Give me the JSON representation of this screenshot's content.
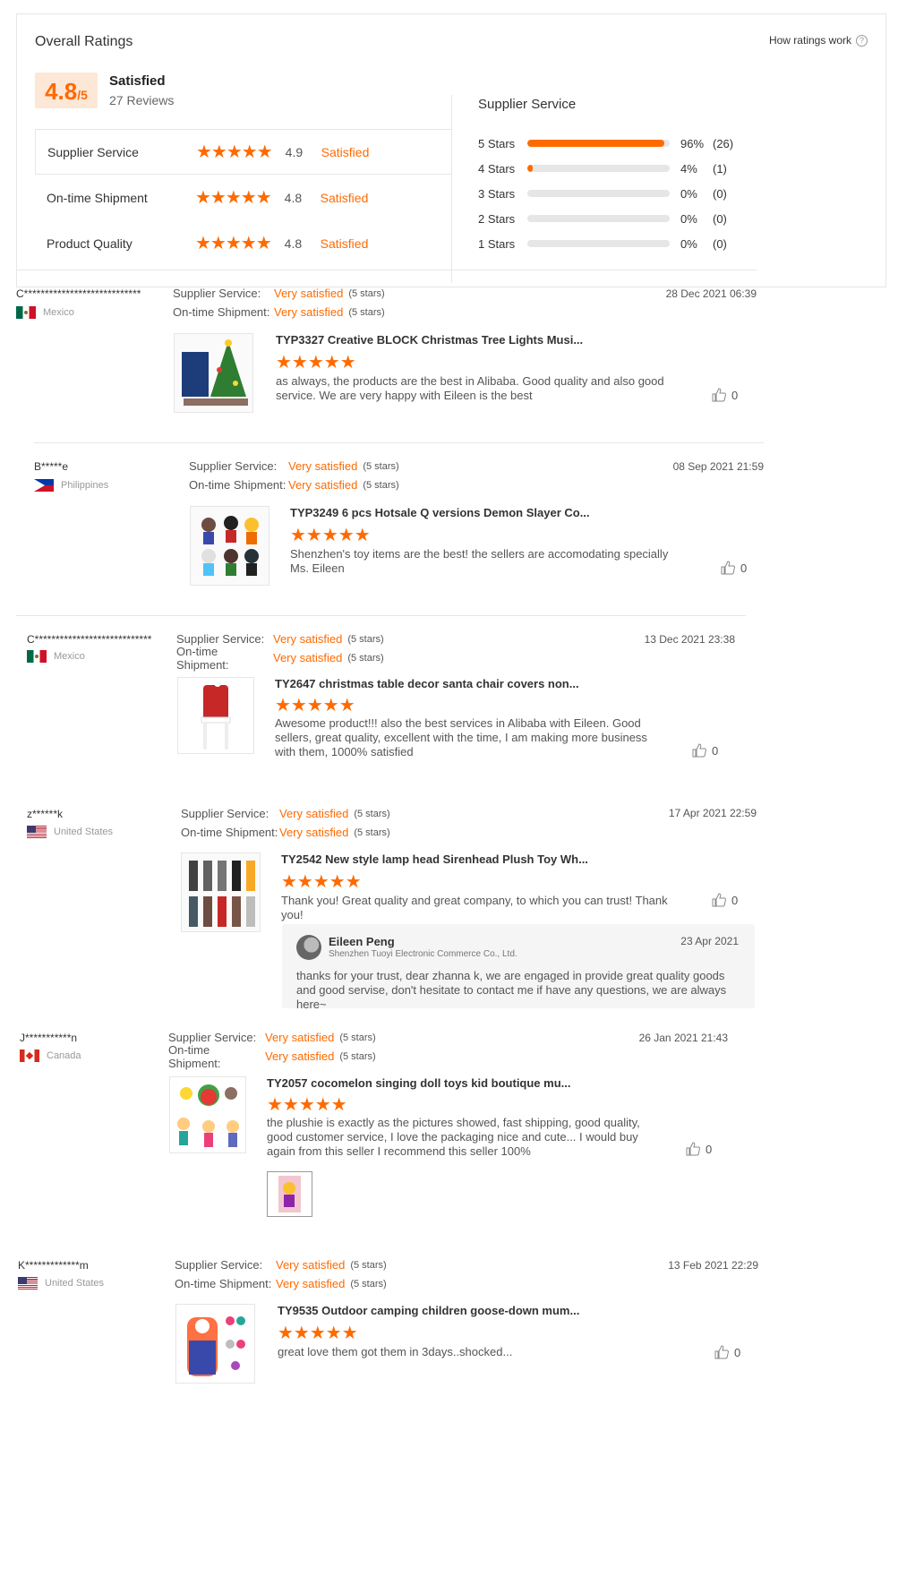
{
  "overall": {
    "title": "Overall Ratings",
    "how_link": "How ratings work",
    "score": "4.8",
    "score_suffix": "/5",
    "satisfaction": "Satisfied",
    "reviews_count": "27 Reviews",
    "categories": [
      {
        "name": "Supplier Service",
        "score": "4.9",
        "satisfaction": "Satisfied",
        "stars": "★★★★★"
      },
      {
        "name": "On-time Shipment",
        "score": "4.8",
        "satisfaction": "Satisfied",
        "stars": "★★★★★"
      },
      {
        "name": "Product Quality",
        "score": "4.8",
        "satisfaction": "Satisfied",
        "stars": "★★★★★"
      }
    ],
    "distribution_title": "Supplier Service",
    "distribution": [
      {
        "label": "5 Stars",
        "fraction": 0.96,
        "pct": "96%",
        "count": "(26)"
      },
      {
        "label": "4 Stars",
        "fraction": 0.04,
        "pct": "4%",
        "count": "(1)"
      },
      {
        "label": "3 Stars",
        "fraction": 0,
        "pct": "0%",
        "count": "(0)"
      },
      {
        "label": "2 Stars",
        "fraction": 0,
        "pct": "0%",
        "count": "(0)"
      },
      {
        "label": "1 Stars",
        "fraction": 0,
        "pct": "0%",
        "count": "(0)"
      }
    ]
  },
  "meta_labels": {
    "supplier": "Supplier Service:",
    "shipment": "On-time Shipment:",
    "very_satisfied": "Very satisfied",
    "five_stars": "(5 stars)"
  },
  "stars_five": "★★★★★",
  "reviews": [
    {
      "user": "C****************************",
      "country": "Mexico",
      "flag": "mx",
      "date": "28 Dec 2021 06:39",
      "product": "TYP3327 Creative BLOCK Christmas Tree Lights Musi...",
      "text": "as always,  the products  are the  best in Alibaba. Good quality and also good service. We are very happy with Eileen is the best",
      "likes": "0"
    },
    {
      "user": "B*****e",
      "country": "Philippines",
      "flag": "ph",
      "date": "08 Sep 2021 21:59",
      "product": "TYP3249 6 pcs Hotsale Q versions Demon Slayer Co...",
      "text": "Shenzhen's toy items are the best! the sellers are accomodating specially Ms. Eileen",
      "likes": "0"
    },
    {
      "user": "C****************************",
      "country": "Mexico",
      "flag": "mx",
      "date": "13 Dec 2021 23:38",
      "product": "TY2647 christmas table decor santa chair covers non...",
      "text": "Awesome product!!! also the best services in Alibaba with Eileen. Good sellers, great quality, excellent with the time, I am making more business with them, 1000% satisfied",
      "likes": "0"
    },
    {
      "user": "z******k",
      "country": "United States",
      "flag": "us",
      "date": "17 Apr 2021 22:59",
      "product": "TY2542 New style lamp head Sirenhead Plush Toy Wh...",
      "text": "Thank you! Great quality and great company, to which you can trust! Thank you!",
      "likes": "0",
      "reply": {
        "name": "Eileen Peng",
        "company": "Shenzhen Tuoyi Electronic Commerce Co., Ltd.",
        "date": "23 Apr 2021",
        "text": "thanks for  your trust, dear zhanna k, we are engaged in provide great quality goods and good servise, don't hesitate to contact me if have any questions, we are always here~"
      }
    },
    {
      "user": "J***********n",
      "country": "Canada",
      "flag": "ca",
      "date": "26 Jan 2021 21:43",
      "product": "TY2057 cocomelon singing doll toys kid boutique mu...",
      "text": "the plushie is exactly as the pictures showed, fast shipping, good quality, good customer service, I love the packaging nice and cute... I would buy again from this seller I recommend this seller 100%",
      "likes": "0"
    },
    {
      "user": "K*************m",
      "country": "United States",
      "flag": "us",
      "date": "13 Feb 2021 22:29",
      "product": "TY9535 Outdoor camping children goose-down mum...",
      "text": "great love them got them in 3days..shocked...",
      "likes": "0"
    }
  ]
}
